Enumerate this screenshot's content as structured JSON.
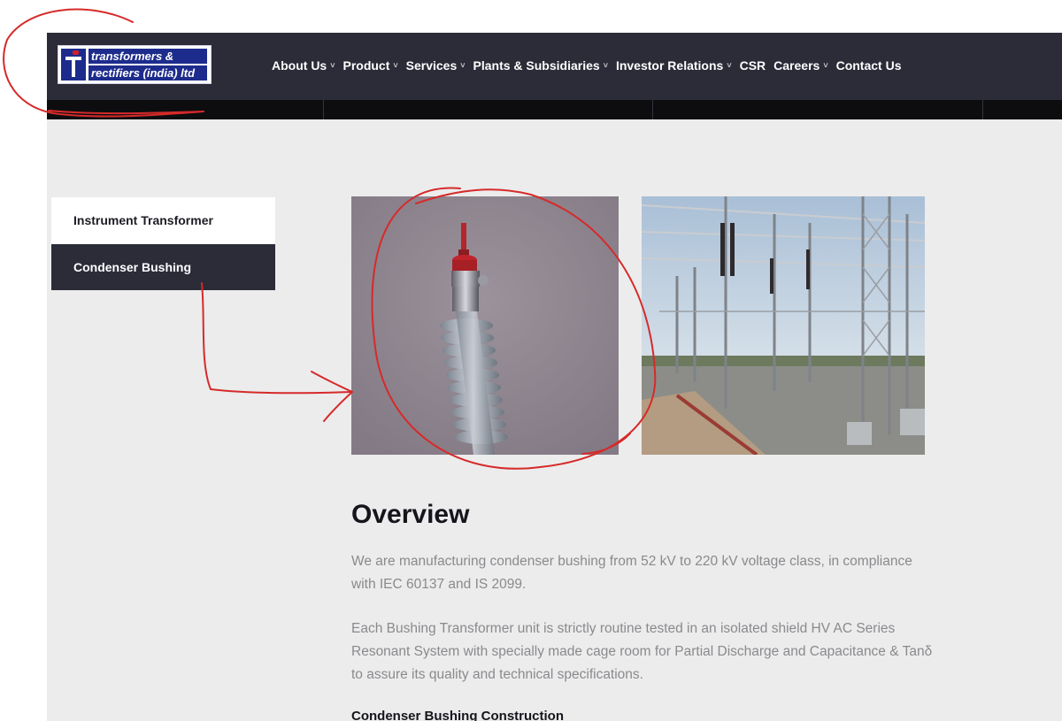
{
  "logo": {
    "line1": "transformers &",
    "line2": "rectifiers (india) ltd"
  },
  "nav": {
    "items": [
      {
        "label": "About Us",
        "has_dropdown": true
      },
      {
        "label": "Product",
        "has_dropdown": true
      },
      {
        "label": "Services",
        "has_dropdown": true
      },
      {
        "label": "Plants & Subsidiaries",
        "has_dropdown": true
      },
      {
        "label": "Investor Relations",
        "has_dropdown": true
      },
      {
        "label": "CSR",
        "has_dropdown": false
      },
      {
        "label": "Careers",
        "has_dropdown": true
      },
      {
        "label": "Contact Us",
        "has_dropdown": false
      }
    ],
    "chevron": "˅"
  },
  "sidebar": {
    "items": [
      {
        "label": "Instrument Transformer",
        "active": false
      },
      {
        "label": "Condenser Bushing",
        "active": true
      }
    ]
  },
  "content": {
    "title": "Overview",
    "paragraphs": [
      "We are manufacturing condenser bushing from 52 kV to 220 kV voltage class, in compliance with IEC 60137 and IS 2099.",
      "Each Bushing Transformer unit is strictly routine tested  in an isolated shield HV AC Series Resonant System with specially made cage room for Partial Discharge and Capacitance & Tanδ to assure its quality and technical specifications."
    ],
    "subheading": "Condenser Bushing Construction"
  },
  "colors": {
    "header_bg": "#2b2c38",
    "page_bg": "#ececec",
    "logo_blue": "#1d2c8c",
    "logo_red": "#d21e2b",
    "annotation_red": "#d62a2a"
  }
}
